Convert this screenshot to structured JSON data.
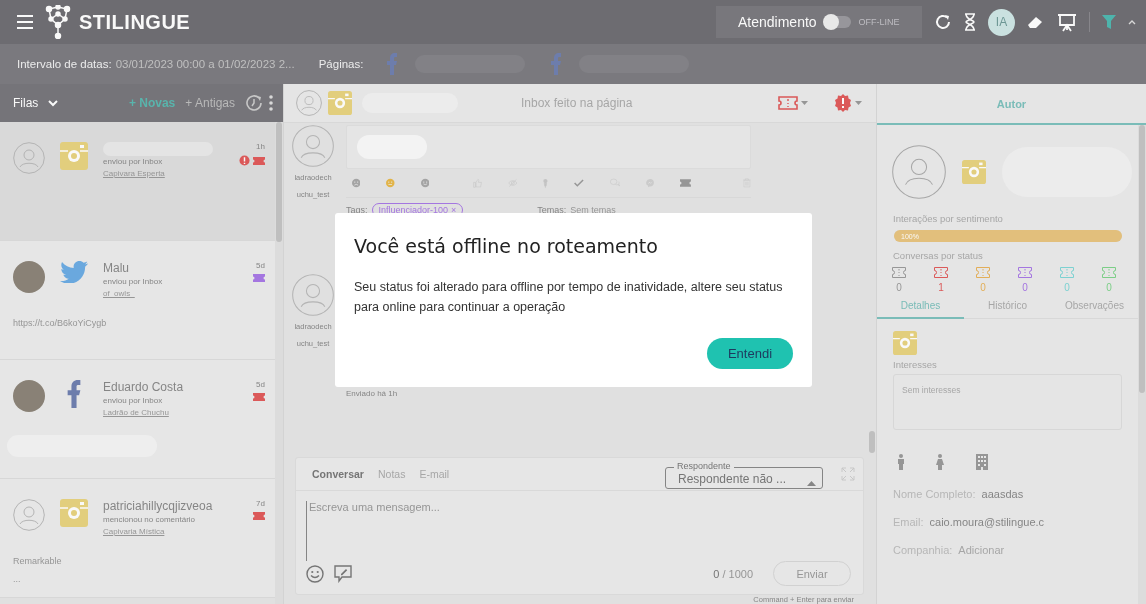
{
  "top_bar": {
    "brand": "STILINGUE",
    "attendance": {
      "label": "Atendimento",
      "on": false,
      "status": "OFF-LINE"
    },
    "avatar_initials": "IA"
  },
  "filters": {
    "date_label": "Intervalo de datas:",
    "date_value": "03/01/2023 00:00 a 01/02/2023 2...",
    "pages_label": "Páginas:",
    "pages": [
      {
        "kind": "facebook"
      },
      {
        "kind": "facebook"
      }
    ]
  },
  "queue": {
    "title": "Filas",
    "tabs": [
      {
        "label": "+ Novas",
        "selected": true
      },
      {
        "label": "+ Antigas",
        "selected": false
      }
    ],
    "cards": [
      {
        "selected": true,
        "avatar": {
          "kind": "placeholder"
        },
        "network": {
          "kind": "instagram"
        },
        "name_redacted": true,
        "action": "enviou por Inbox",
        "page": "Capivara Esperta",
        "time": "1h",
        "alert": true,
        "ticket": {
          "color": "#e05a5a"
        }
      },
      {
        "selected": false,
        "avatar": {
          "kind": "photo"
        },
        "network": {
          "kind": "twitter"
        },
        "name": "Malu",
        "action": "enviou por Inbox",
        "page": "of_owls_",
        "time": "5d",
        "alert": false,
        "ticket": {
          "color": "#a878e6"
        },
        "text": [
          "https://t.co/B6koYiCygb"
        ]
      },
      {
        "selected": false,
        "avatar": {
          "kind": "photo"
        },
        "network": {
          "kind": "facebook"
        },
        "name": "Eduardo Costa",
        "action": "enviou por Inbox",
        "page": "Ladrão de Chuchu",
        "time": "5d",
        "alert": false,
        "ticket": {
          "color": "#e05a5a"
        },
        "preview_redacted": true
      },
      {
        "selected": false,
        "avatar": {
          "kind": "placeholder"
        },
        "network": {
          "kind": "instagram"
        },
        "name": "patriciahillycqjizveoa",
        "action": "mencionou no comentário",
        "page": "Capivaria Mística",
        "time": "7d",
        "alert": false,
        "ticket": {
          "color": "#e05a5a"
        },
        "text": [
          "Remarkable",
          "..."
        ]
      }
    ]
  },
  "conversation": {
    "network": {
      "kind": "instagram"
    },
    "title": "Inbox feito na página",
    "messages": [
      {
        "user": "ladraodechuchu_test",
        "sentiments": [
          {
            "kind": "negative",
            "selected": false
          },
          {
            "kind": "neutral",
            "selected": true
          },
          {
            "kind": "positive",
            "selected": false
          }
        ],
        "tags_label": "Tags:",
        "tags": [
          {
            "label": "Influenciador-100",
            "remove": "×"
          }
        ],
        "topics_label": "Temas:",
        "topics": "Sem temas"
      },
      {
        "user": "ladraodechuchu_test",
        "sent": "Enviado há 1h"
      }
    ],
    "composer": {
      "tabs": [
        {
          "label": "Conversar",
          "selected": true
        },
        {
          "label": "Notas",
          "selected": false
        },
        {
          "label": "E-mail",
          "selected": false
        }
      ],
      "respondent_legend": "Respondente",
      "respondent_value": "Respondente não ...",
      "placeholder": "Escreva uma mensagem...",
      "counter": "0",
      "limit": "/ 1000",
      "send": "Enviar",
      "send_disabled": true,
      "hint": "Command + Enter para enviar"
    }
  },
  "author": {
    "tab": "Autor",
    "network": {
      "kind": "instagram"
    },
    "sentiment_label": "Interações por sentimento",
    "sentiment_bar": {
      "level": 1,
      "reading": "100%"
    },
    "status_label": "Conversas por status",
    "statuses": [
      {
        "color": "#9a9a9a",
        "count": "0"
      },
      {
        "color": "#e05a5a",
        "count": "1"
      },
      {
        "color": "#e8b25a",
        "count": "0"
      },
      {
        "color": "#a878e6",
        "count": "0"
      },
      {
        "color": "#7fd6d6",
        "count": "0"
      },
      {
        "color": "#7ed38a",
        "count": "0"
      }
    ],
    "tabs": [
      {
        "label": "Detalhes",
        "selected": true
      },
      {
        "label": "Histórico",
        "selected": false
      },
      {
        "label": "Observações",
        "selected": false
      }
    ],
    "interests_label": "Interesses",
    "interests_value": "Sem interesses",
    "fields": [
      {
        "label": "Nome Completo:",
        "value": "aaasdas",
        "kind": "value"
      },
      {
        "label": "Email:",
        "value": "caio.moura@stilingue.c",
        "kind": "value"
      },
      {
        "label": "Companhia:",
        "value": "Adicionar",
        "kind": "placeholder"
      }
    ]
  },
  "modal": {
    "title": "Você está offline no roteamento",
    "message": "Seu status foi alterado para offline por tempo de inatividade, altere seu status para online para continuar a operação",
    "button": "Entendi"
  }
}
